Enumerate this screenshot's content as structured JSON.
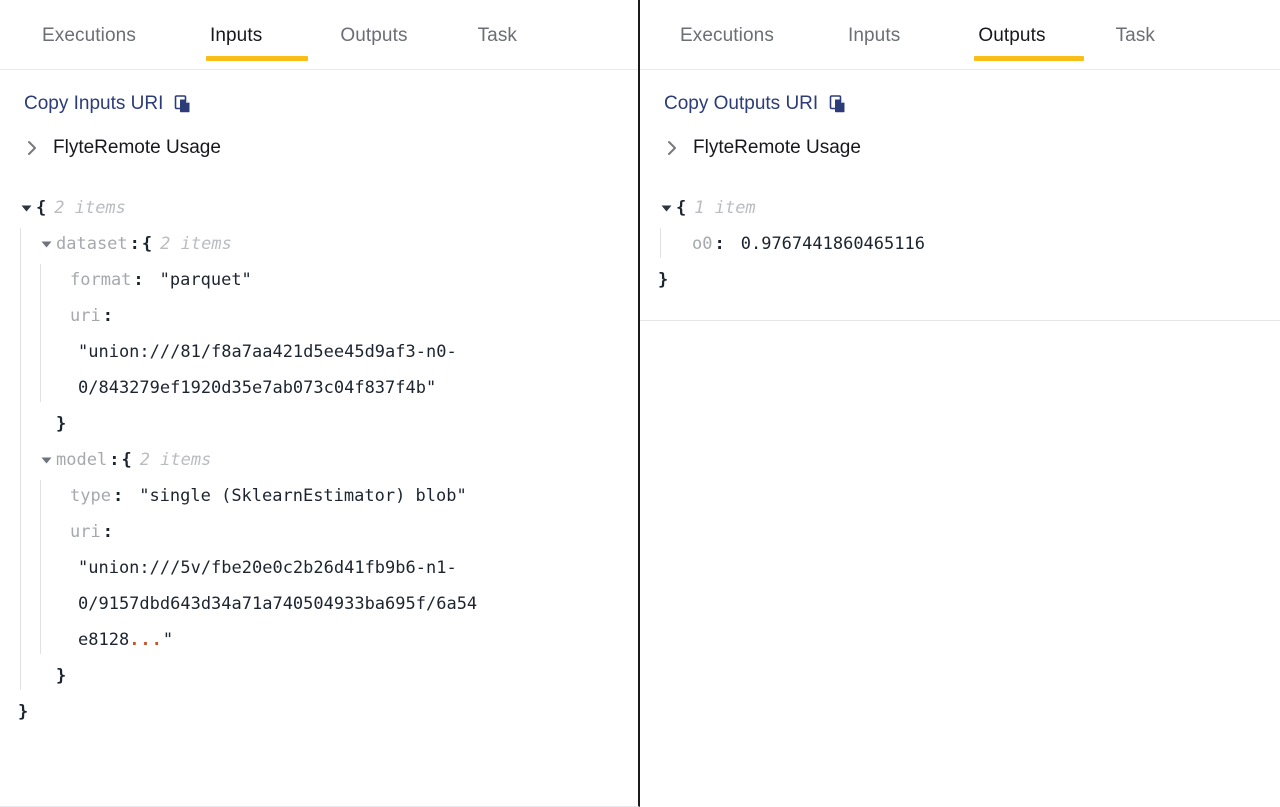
{
  "left_panel": {
    "tabs": [
      {
        "label": "Executions",
        "active": false
      },
      {
        "label": "Inputs",
        "active": true
      },
      {
        "label": "Outputs",
        "active": false
      },
      {
        "label": "Task",
        "active": false
      }
    ],
    "copy_link": {
      "label": "Copy Inputs URI",
      "icon": "copy-icon"
    },
    "node": {
      "label": "FlyteRemote Usage",
      "icon": "chevron-right-icon",
      "expanded": false
    },
    "json": {
      "root_brace_open": "{",
      "root_count": "2 items",
      "root_brace_close": "}",
      "dataset": {
        "key": "dataset",
        "brace_open": "{",
        "count": "2 items",
        "brace_close": "}",
        "format_key": "format",
        "format_value": "\"parquet\"",
        "uri_key": "uri",
        "uri_line1": "\"union:///81/f8a7aa421d5ee45d9af3-n0-",
        "uri_line2": "0/843279ef1920d35e7ab073c04f837f4b\""
      },
      "model": {
        "key": "model",
        "brace_open": "{",
        "count": "2 items",
        "brace_close": "}",
        "type_key": "type",
        "type_value": "\"single (SklearnEstimator) blob\"",
        "uri_key": "uri",
        "uri_line1": "\"union:///5v/fbe20e0c2b26d41fb9b6-n1-",
        "uri_line2": "0/9157dbd643d34a71a740504933ba695f/6a54",
        "uri_line3_prefix": "e8128",
        "uri_line3_ellipsis": "...",
        "uri_line3_suffix": "\""
      },
      "colon": ":"
    }
  },
  "right_panel": {
    "tabs": [
      {
        "label": "Executions",
        "active": false
      },
      {
        "label": "Inputs",
        "active": false
      },
      {
        "label": "Outputs",
        "active": true
      },
      {
        "label": "Task",
        "active": false
      }
    ],
    "copy_link": {
      "label": "Copy Outputs URI",
      "icon": "copy-icon"
    },
    "node": {
      "label": "FlyteRemote Usage",
      "icon": "chevron-right-icon",
      "expanded": false
    },
    "json": {
      "root_brace_open": "{",
      "root_count": "1 item",
      "root_brace_close": "}",
      "o0_key": "o0",
      "o0_value": "0.9767441860465116",
      "colon": ":"
    }
  },
  "colors": {
    "active_tab_underline": "#f9be17",
    "link": "#2b3c78",
    "tab_inactive": "#6b6e74",
    "tab_active": "#17181c",
    "json_key": "#a5a8ad",
    "json_count": "#b9bcc1",
    "json_value": "#1c2430",
    "ellipsis": "#c2552a",
    "divider": "#1b1b1f"
  }
}
